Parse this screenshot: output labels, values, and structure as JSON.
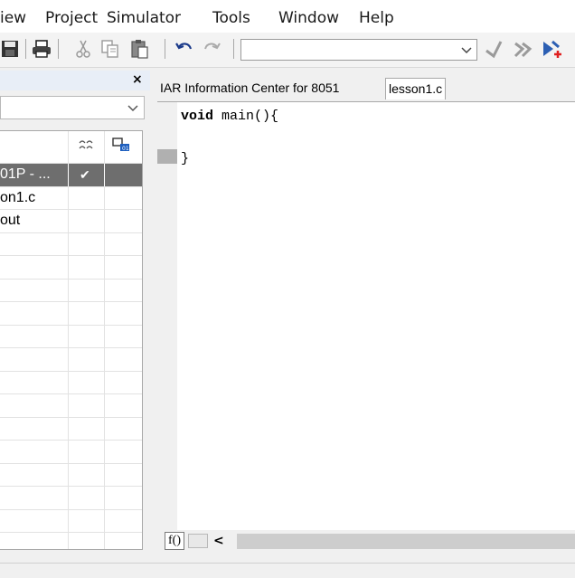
{
  "menu": {
    "items": [
      "iew",
      "Project",
      "Simulator",
      "Tools",
      "Window",
      "Help"
    ]
  },
  "toolbar": {
    "icons": [
      "save-all-icon",
      "print-icon",
      "cut-icon",
      "copy-icon",
      "paste-icon",
      "undo-icon",
      "redo-icon",
      "find-icon",
      "find-next-icon",
      "debug-icon"
    ],
    "combo_value": ""
  },
  "workspace": {
    "close_label": "×",
    "config_value": "",
    "column_icons": [
      "make-status-icon",
      "options-icon"
    ],
    "rows": [
      {
        "name": "01P - ...",
        "check": "✔",
        "selected": true
      },
      {
        "name": "on1.c",
        "check": "",
        "selected": false
      },
      {
        "name": "out",
        "check": "",
        "selected": false
      }
    ]
  },
  "tabs": [
    {
      "label": "IAR Information Center for 8051",
      "active": false
    },
    {
      "label": "lesson1.c",
      "active": true
    }
  ],
  "editor": {
    "lines": [
      {
        "keyword": "void",
        "rest": " main(){"
      },
      {
        "keyword": "",
        "rest": ""
      },
      {
        "keyword": "",
        "rest": "}"
      }
    ]
  },
  "bottom": {
    "fo_label": "f()",
    "scroll_left": "<"
  }
}
